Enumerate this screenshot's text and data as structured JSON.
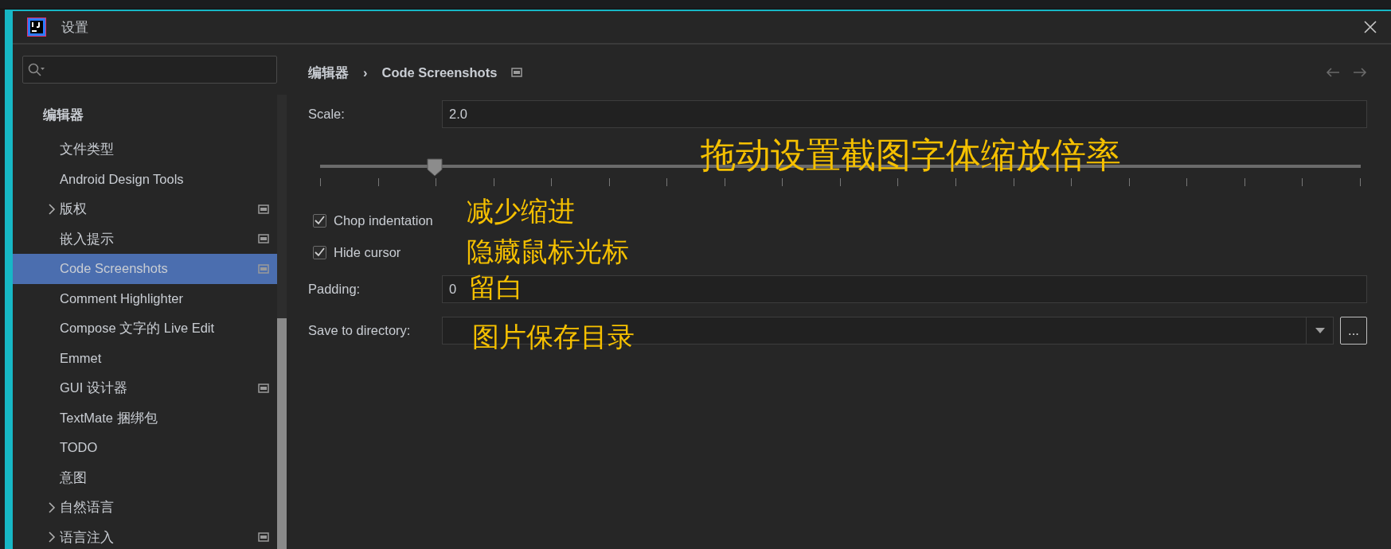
{
  "window": {
    "title": "设置"
  },
  "sidebar": {
    "header": "编辑器",
    "items": [
      {
        "label": "文件类型",
        "collapsible": false,
        "scope_icon": false,
        "selected": false
      },
      {
        "label": "Android Design Tools",
        "collapsible": false,
        "scope_icon": false,
        "selected": false
      },
      {
        "label": "版权",
        "collapsible": true,
        "scope_icon": true,
        "selected": false
      },
      {
        "label": "嵌入提示",
        "collapsible": false,
        "scope_icon": true,
        "selected": false
      },
      {
        "label": "Code Screenshots",
        "collapsible": false,
        "scope_icon": true,
        "selected": true
      },
      {
        "label": "Comment Highlighter",
        "collapsible": false,
        "scope_icon": false,
        "selected": false
      },
      {
        "label": "Compose 文字的 Live Edit",
        "collapsible": false,
        "scope_icon": false,
        "selected": false
      },
      {
        "label": "Emmet",
        "collapsible": false,
        "scope_icon": false,
        "selected": false
      },
      {
        "label": "GUI 设计器",
        "collapsible": false,
        "scope_icon": true,
        "selected": false
      },
      {
        "label": "TextMate 捆绑包",
        "collapsible": false,
        "scope_icon": false,
        "selected": false
      },
      {
        "label": "TODO",
        "collapsible": false,
        "scope_icon": false,
        "selected": false
      },
      {
        "label": "意图",
        "collapsible": false,
        "scope_icon": false,
        "selected": false
      },
      {
        "label": "自然语言",
        "collapsible": true,
        "scope_icon": false,
        "selected": false
      },
      {
        "label": "语言注入",
        "collapsible": true,
        "scope_icon": true,
        "selected": false
      }
    ]
  },
  "breadcrumb": {
    "items": [
      "编辑器",
      "Code Screenshots"
    ],
    "separator": "›"
  },
  "settings": {
    "scale": {
      "label": "Scale:",
      "value": "2.0"
    },
    "slider": {
      "level": 0.11,
      "note": "拖动设置截图字体缩放倍率"
    },
    "checkboxes": [
      {
        "label": "Chop indentation",
        "checked": true,
        "note": "减少缩进"
      },
      {
        "label": "Hide cursor",
        "checked": true,
        "note": "隐藏鼠标光标"
      }
    ],
    "padding": {
      "label": "Padding:",
      "value": "0",
      "note": "留白"
    },
    "save_directory": {
      "label": "Save to directory:",
      "browse": "...",
      "note": "图片保存目录"
    }
  }
}
